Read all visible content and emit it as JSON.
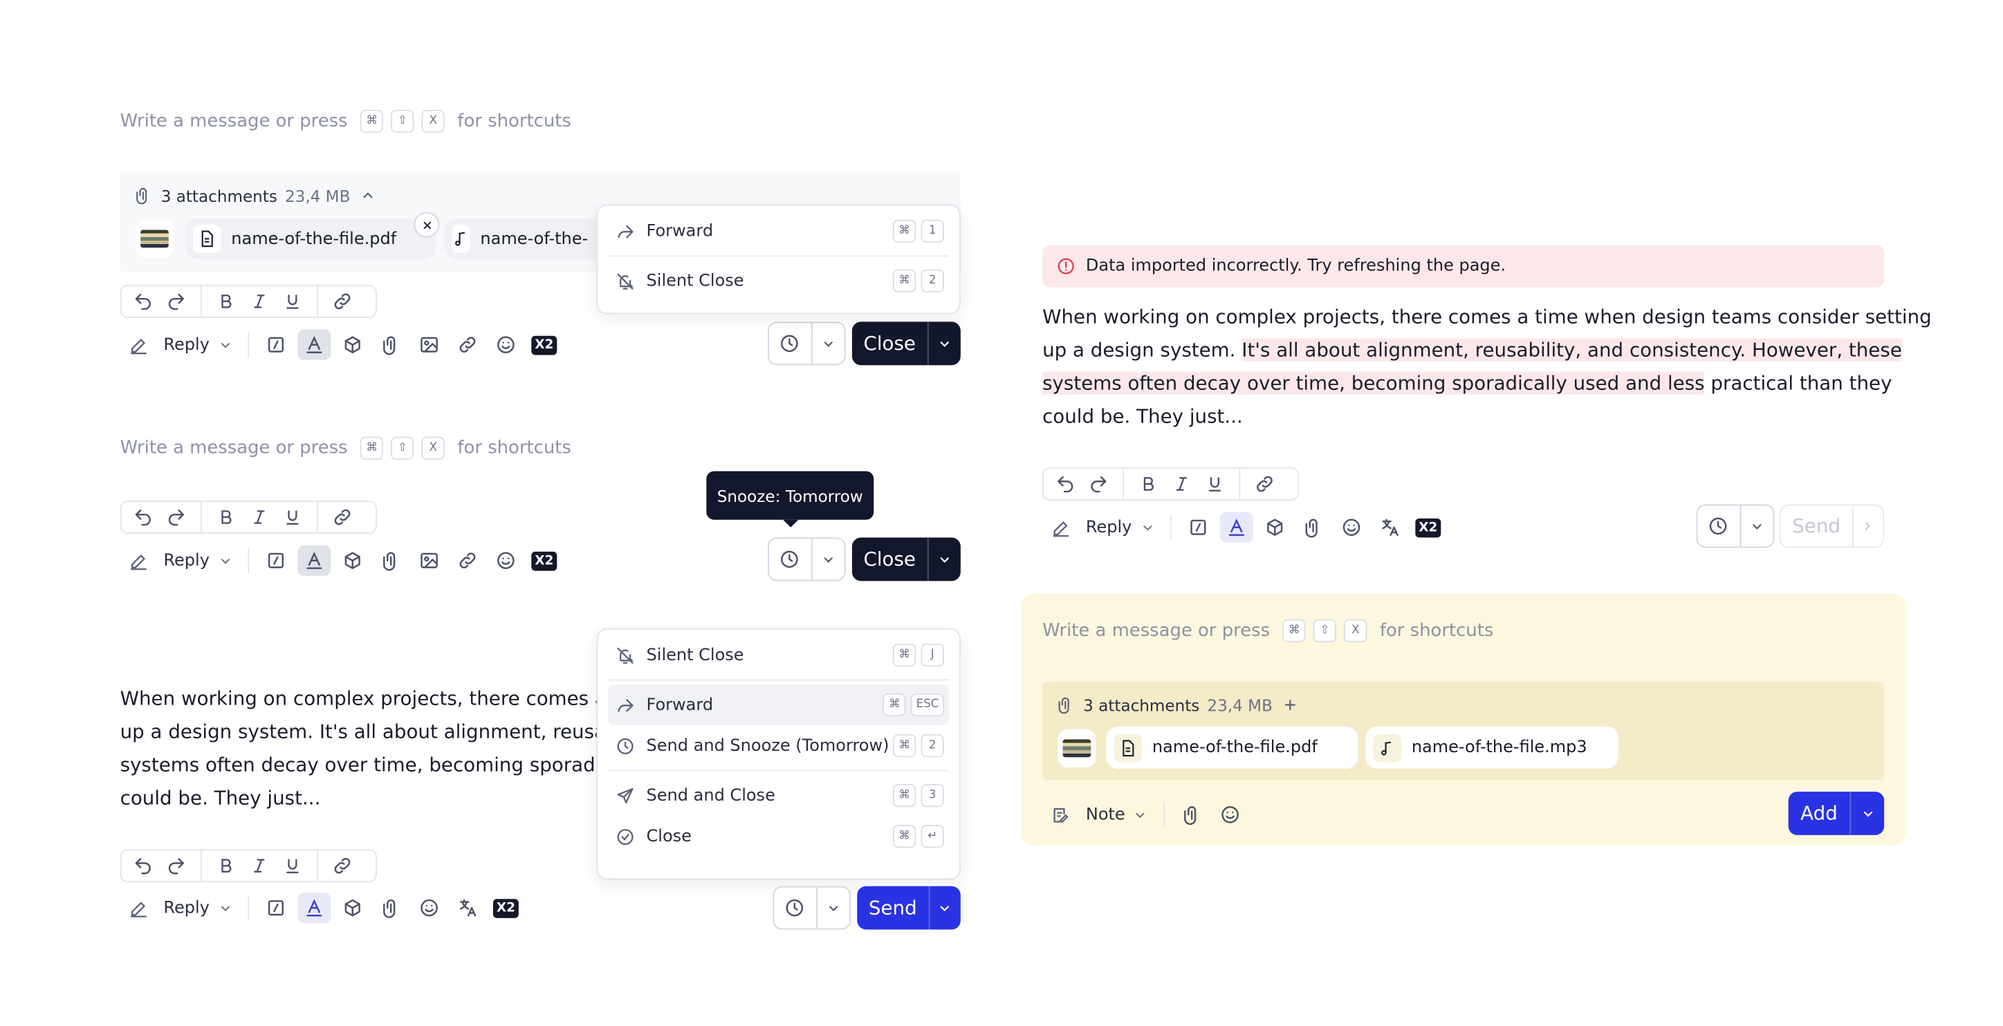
{
  "placeholder": {
    "prefix": "Write a message or press",
    "suffix": "for shortcuts",
    "keys": [
      "⌘",
      "⇧",
      "X"
    ]
  },
  "mode": {
    "reply": "Reply",
    "note": "Note"
  },
  "buttons": {
    "close": "Close",
    "send": "Send",
    "add": "Add"
  },
  "x2_label": "X2",
  "attachments": {
    "count_label": "3 attachments",
    "size": "23,4 MB",
    "file_pdf": "name-of-the-file.pdf",
    "file_mp3": "name-of-the-file.mp3",
    "file_mp3_truncated": "name-of-the-"
  },
  "menu1": [
    {
      "label": "Forward",
      "keys": [
        "⌘",
        "1"
      ]
    },
    {
      "label": "Silent Close",
      "keys": [
        "⌘",
        "2"
      ]
    }
  ],
  "menu2": [
    {
      "label": "Silent Close",
      "keys": [
        "⌘",
        "J"
      ]
    },
    {
      "label": "Forward",
      "keys": [
        "⌘",
        "ESC"
      ]
    },
    {
      "label": "Send and Snooze (Tomorrow)",
      "keys": [
        "⌘",
        "2"
      ]
    },
    {
      "label": "Send and Close",
      "keys": [
        "⌘",
        "3"
      ]
    },
    {
      "label": "Close",
      "keys": [
        "⌘",
        "↵"
      ]
    }
  ],
  "tooltip": {
    "label": "Snooze:",
    "value": "Tomorrow"
  },
  "message": {
    "line1": "When working on complex projects, there comes a time when design teams consider setting",
    "line2a": "up a design system. ",
    "line2b": "It's all about alignment, reusability, and consistency. However, these",
    "line3a": "systems often decay over time, becoming sporadically used and less",
    "line3b": " practical than they",
    "line4": "could be. They just...",
    "t1": "When working on complex projects, there comes a tim",
    "t2": "up a design system. It's all about alignment, reusabilit",
    "t3": "systems often decay over time, becoming sporadicall",
    "t4": "could be. They just..."
  },
  "error": {
    "text": "Data imported incorrectly. Try refreshing the page."
  },
  "colors": {
    "primary": "#2a33e3",
    "dark": "#13172b",
    "error_bg": "#fce8ea",
    "note_bg": "#fdf7df"
  }
}
